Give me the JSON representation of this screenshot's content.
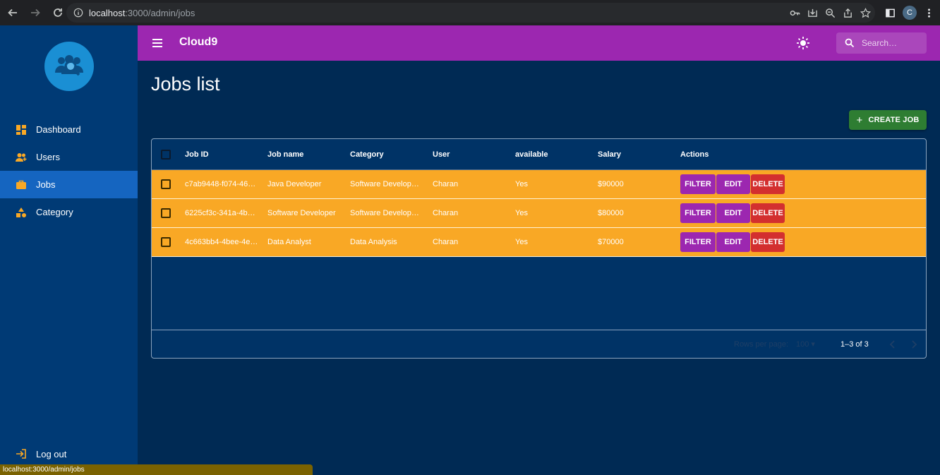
{
  "browser": {
    "url_host": "localhost",
    "url_path": ":3000/admin/jobs",
    "profile_initial": "C"
  },
  "app": {
    "title": "Cloud9",
    "search_placeholder": "Search…"
  },
  "sidebar": {
    "items": [
      {
        "label": "Dashboard",
        "icon": "dashboard-icon"
      },
      {
        "label": "Users",
        "icon": "users-icon"
      },
      {
        "label": "Jobs",
        "icon": "briefcase-icon",
        "active": true
      },
      {
        "label": "Category",
        "icon": "category-icon"
      }
    ],
    "logout_label": "Log out"
  },
  "page": {
    "title": "Jobs list",
    "create_label": "CREATE JOB"
  },
  "table": {
    "columns": [
      "Job ID",
      "Job name",
      "Category",
      "User",
      "available",
      "Salary",
      "Actions"
    ],
    "rows": [
      {
        "id": "c7ab9448-f074-46…",
        "name": "Java Developer",
        "category": "Software Develop…",
        "user": "Charan",
        "available": "Yes",
        "salary": "$90000"
      },
      {
        "id": "6225cf3c-341a-4b…",
        "name": "Software Developer",
        "category": "Software Develop…",
        "user": "Charan",
        "available": "Yes",
        "salary": "$80000"
      },
      {
        "id": "4c663bb4-4bee-4e…",
        "name": "Data Analyst",
        "category": "Data Analysis",
        "user": "Charan",
        "available": "Yes",
        "salary": "$70000"
      }
    ],
    "actions": {
      "filter": "FILTER",
      "edit": "EDIT",
      "delete": "DELETE"
    },
    "footer": {
      "rows_per_page_label": "Rows per page:",
      "rows_per_page_value": "100",
      "page_info": "1–3 of 3"
    }
  },
  "status_tip": "localhost:3000/admin/jobs",
  "colors": {
    "appbar": "#9c27b0",
    "sidebar": "#003a75",
    "background": "#002a54",
    "row": "#f9a825",
    "create": "#2e7d32",
    "delete": "#d32f2f"
  }
}
